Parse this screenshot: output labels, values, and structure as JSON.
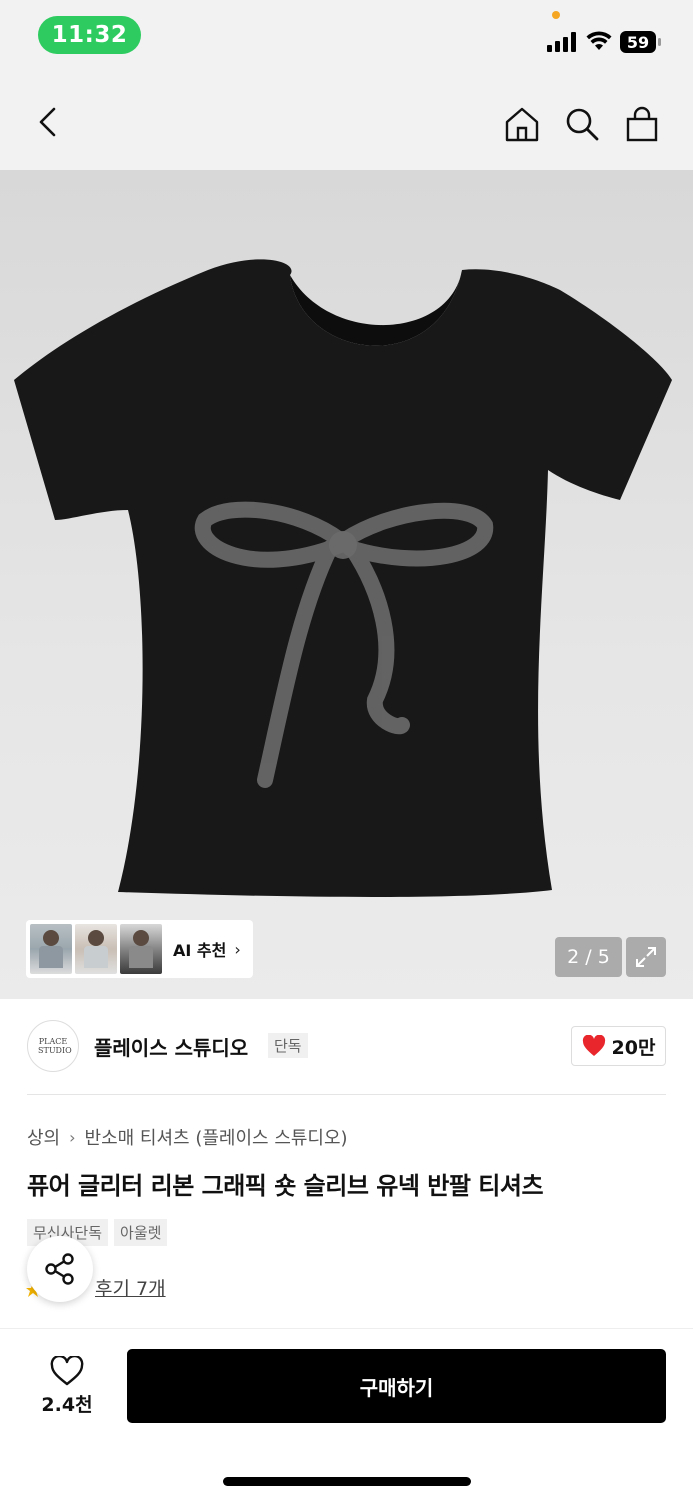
{
  "status_bar": {
    "time": "11:32",
    "battery": "59"
  },
  "hero": {
    "page_indicator": "2 / 5",
    "ai_recommend_label": "AI 추천",
    "ai_arrow": "›"
  },
  "brand": {
    "name": "플레이스 스튜디오",
    "badge": "단독",
    "likes": "20만",
    "logo_text": "PLACE STUDIO"
  },
  "breadcrumb": {
    "category": "상의",
    "separator": "›",
    "subcategory": "반소매 티셔츠 (플레이스 스튜디오)"
  },
  "product": {
    "title": "퓨어 글리터 리본 그래픽 숏 슬리브 유넥 반팔 티셔츠",
    "tags": [
      "무신사단독",
      "아울렛"
    ],
    "review_link": "후기 7개"
  },
  "bottom_bar": {
    "wish_count": "2.4천",
    "buy_label": "구매하기"
  },
  "colors": {
    "accent_green": "#2ecc60",
    "heart_red": "#e8262c",
    "buy_button": "#000000"
  },
  "icons": [
    "back-icon",
    "home-icon",
    "search-icon",
    "shopping-bag-icon",
    "expand-icon",
    "heart-icon",
    "share-icon",
    "heart-outline-icon"
  ]
}
